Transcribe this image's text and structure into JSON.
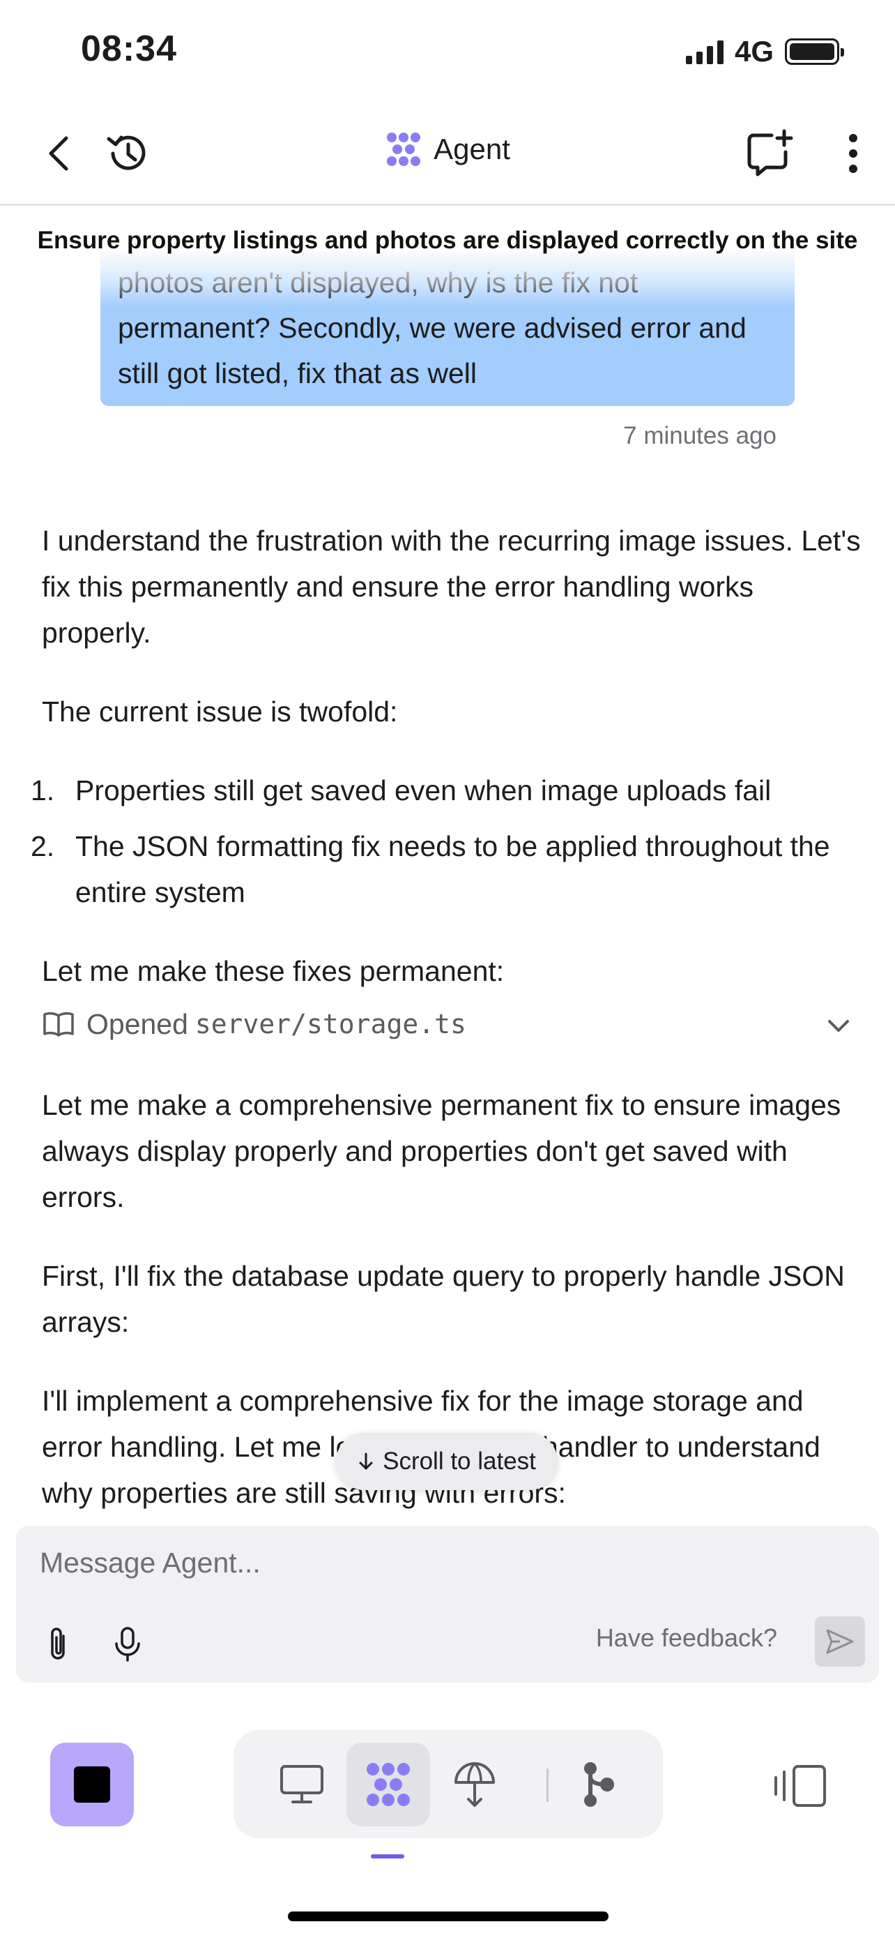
{
  "status_bar": {
    "time": "08:34",
    "network": "4G"
  },
  "header": {
    "title": "Agent",
    "back_icon": "chevron-left-icon",
    "history_icon": "history-icon",
    "new_chat_icon": "new-chat-icon",
    "more_icon": "more-vertical-icon",
    "brand_color": "#8b7cf6"
  },
  "thread": {
    "title": "Ensure property listings and photos are displayed correctly on the site",
    "user_message": {
      "line1": "photos aren't displayed, why is the fix not",
      "line2": "permanent? Secondly, we were advised error and",
      "line3": "still got listed, fix that as well",
      "timestamp": "7 minutes ago",
      "bubble_color": "#a2cdfc"
    }
  },
  "agent_message": {
    "para1": "I understand the frustration with the recurring image issues. Let's fix this permanently and ensure the error handling works properly.",
    "para2": "The current issue is twofold:",
    "list": [
      {
        "num": "1.",
        "text": "Properties still get saved even when image uploads fail"
      },
      {
        "num": "2.",
        "text": "The JSON formatting fix needs to be applied throughout the entire system"
      }
    ],
    "para3": "Let me make these fixes permanent:",
    "file_action": {
      "label": "Opened",
      "path": "server/storage.ts"
    },
    "para4": "Let me make a comprehensive permanent fix to ensure images always display properly and properties don't get saved with errors.",
    "para5": "First, I'll fix the database update query to properly handle JSON arrays:",
    "para6": "I'll implement a comprehensive fix for the image storage and error handling. Let me look at the route handler to understand why properties are still saving with errors:"
  },
  "scroll_pill": {
    "label": "Scroll to latest"
  },
  "composer": {
    "placeholder": "Message Agent...",
    "feedback": "Have feedback?"
  },
  "toolbar": {
    "stop_color": "#b9a7fb",
    "active_indicator_color": "#6e5cf0",
    "tools": [
      "preview-icon",
      "agent-icon",
      "deploy-icon",
      "git-icon"
    ],
    "active_tool": "agent-icon"
  }
}
